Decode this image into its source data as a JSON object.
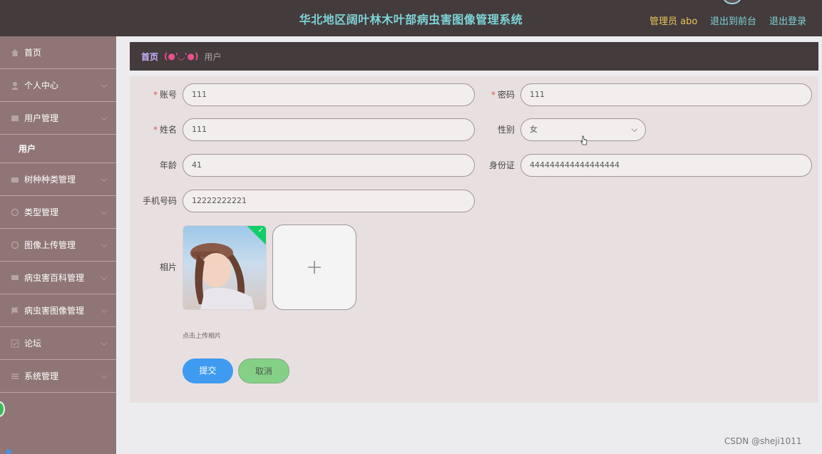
{
  "header": {
    "title": "华北地区阔叶林木叶部病虫害图像管理系统",
    "admin": "管理员 abo",
    "links": [
      "退出到前台",
      "退出登录"
    ]
  },
  "sidebar": {
    "items": [
      {
        "label": "首页",
        "icon": "home-icon"
      },
      {
        "label": "个人中心",
        "icon": "user-icon"
      },
      {
        "label": "用户管理",
        "icon": "table-icon"
      },
      {
        "label": "树种种类管理",
        "icon": "camera-icon"
      },
      {
        "label": "类型管理",
        "icon": "power-icon"
      },
      {
        "label": "图像上传管理",
        "icon": "circle-icon"
      },
      {
        "label": "病虫害百科管理",
        "icon": "chat-icon"
      },
      {
        "label": "病虫害图像管理",
        "icon": "flag-icon"
      },
      {
        "label": "论坛",
        "icon": "check-icon"
      },
      {
        "label": "系统管理",
        "icon": "list-icon"
      }
    ],
    "sub_item": "用户"
  },
  "breadcrumb": {
    "home": "首页",
    "face": "(●'◡'●)",
    "current": "用户"
  },
  "form": {
    "account": {
      "label": "账号",
      "value": "111",
      "required": true
    },
    "password": {
      "label": "密码",
      "value": "111",
      "required": true
    },
    "name": {
      "label": "姓名",
      "value": "111",
      "required": true
    },
    "gender": {
      "label": "性别",
      "value": "女"
    },
    "age": {
      "label": "年龄",
      "value": "41"
    },
    "idcard": {
      "label": "身份证",
      "value": "444444444444444444"
    },
    "phone": {
      "label": "手机号码",
      "value": "12222222221"
    },
    "photo": {
      "label": "相片",
      "tip": "点击上传相片"
    }
  },
  "buttons": {
    "submit": "提交",
    "cancel": "取消"
  },
  "watermark": "CSDN @sheji1011",
  "colors": {
    "topbar": "#433b3c",
    "sidebar": "#8f7575",
    "title": "#7fd3d6",
    "admin": "#e8c55a",
    "submit": "#3f9bf0",
    "cancel": "#85d087"
  }
}
